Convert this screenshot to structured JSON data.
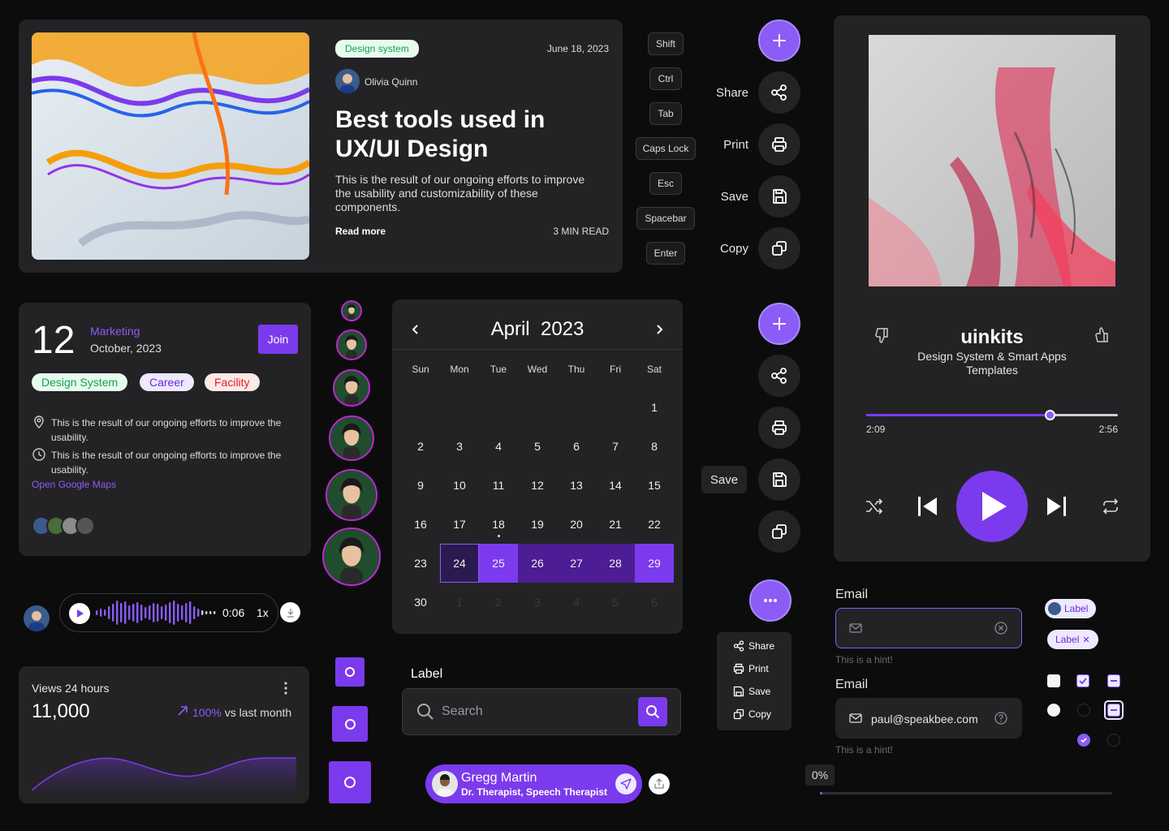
{
  "blog": {
    "badge": "Design system",
    "date": "June 18, 2023",
    "author": "Olivia Quinn",
    "title": "Best tools used in UX/UI Design",
    "description": "This is the result of our ongoing efforts to improve the usability and customizability of these components.",
    "read_more": "Read more",
    "read_time": "3 MIN READ"
  },
  "keys": [
    "Shift",
    "Ctrl",
    "Tab",
    "Caps Lock",
    "Esc",
    "Spacebar",
    "Enter"
  ],
  "actions": {
    "share": "Share",
    "print": "Print",
    "save": "Save",
    "copy": "Copy",
    "tooltip_save": "Save"
  },
  "event": {
    "day": "12",
    "category": "Marketing",
    "month_year": "October, 2023",
    "join": "Join",
    "tags": [
      "Design System",
      "Career",
      "Facility"
    ],
    "line1": "This is the result of our ongoing efforts to improve the usability.",
    "line2": "This is the result of our ongoing efforts to improve the usability.",
    "maps_link": "Open Google Maps"
  },
  "calendar": {
    "month": "April",
    "year": "2023",
    "weekdays": [
      "Sun",
      "Mon",
      "Tue",
      "Wed",
      "Thu",
      "Fri",
      "Sat"
    ],
    "selected_range": [
      24,
      29
    ]
  },
  "audio": {
    "time": "0:06",
    "speed": "1x"
  },
  "views": {
    "title": "Views 24 hours",
    "value": "11,000",
    "change": "100%",
    "change_suffix": "vs last month"
  },
  "search": {
    "label": "Label",
    "placeholder": "Search"
  },
  "contact": {
    "name": "Gregg Martin",
    "role": "Dr. Therapist, Speech Therapist"
  },
  "menu": {
    "share": "Share",
    "print": "Print",
    "save": "Save",
    "copy": "Copy"
  },
  "player": {
    "title": "uinkits",
    "subtitle": "Design System & Smart Apps Templates",
    "elapsed": "2:09",
    "duration": "2:56",
    "progress": 0.73
  },
  "form": {
    "email_label_1": "Email",
    "hint_1": "This is a hint!",
    "email_label_2": "Email",
    "email_value": "paul@speakbee.com",
    "hint_2": "This is a hint!",
    "progress_text": "0%"
  },
  "labels": {
    "label_a": "Label",
    "label_b": "Label"
  },
  "colors": {
    "accent": "#8b5cf6",
    "card": "#232325",
    "background": "#0c0c0d"
  }
}
